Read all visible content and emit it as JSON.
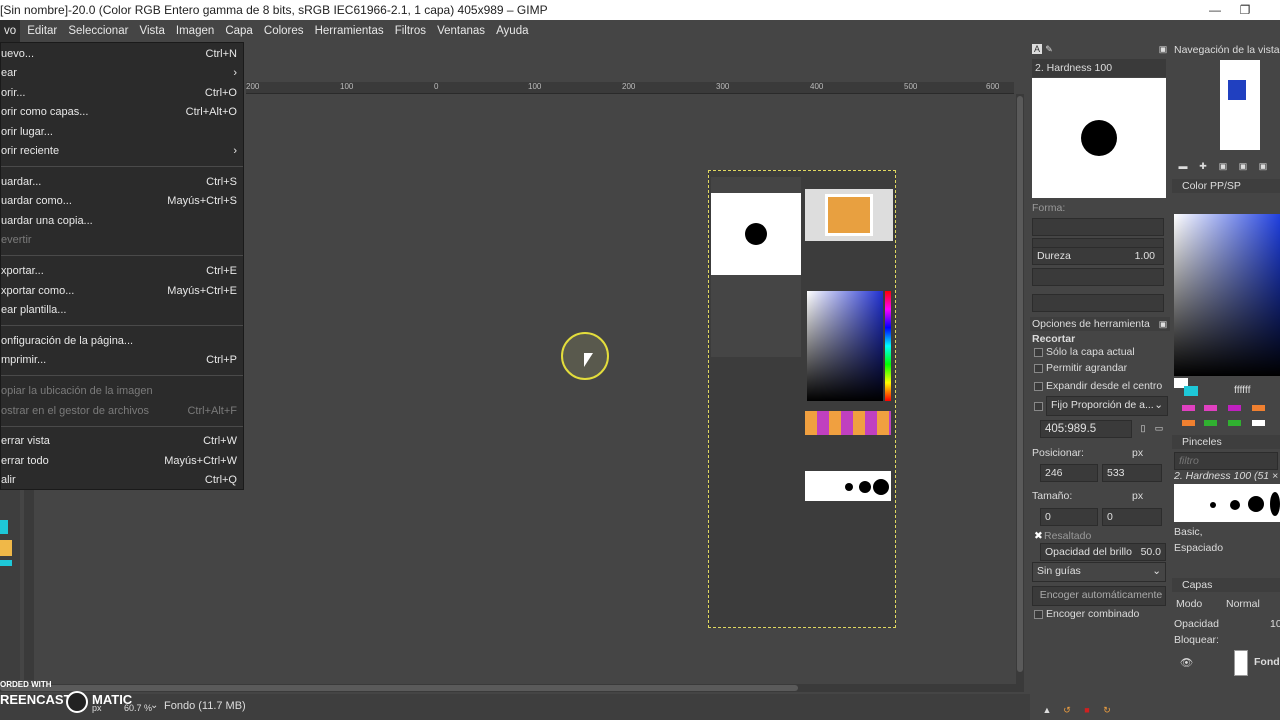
{
  "title": "[Sin nombre]-20.0 (Color RGB Entero gamma de 8 bits, sRGB IEC61966-2.1, 1 capa) 405x989 – GIMP",
  "menubar": [
    "vo",
    "Editar",
    "Seleccionar",
    "Vista",
    "Imagen",
    "Capa",
    "Colores",
    "Herramientas",
    "Filtros",
    "Ventanas",
    "Ayuda"
  ],
  "file_menu": [
    {
      "label": "uevo...",
      "accel": "Ctrl+N"
    },
    {
      "label": "ear",
      "accel": "›"
    },
    {
      "label": "orir...",
      "accel": "Ctrl+O"
    },
    {
      "label": "orir como capas...",
      "accel": "Ctrl+Alt+O"
    },
    {
      "label": "orir lugar...",
      "accel": ""
    },
    {
      "label": "orir reciente",
      "accel": "›"
    },
    {
      "label": "uardar...",
      "accel": "Ctrl+S"
    },
    {
      "label": "uardar como...",
      "accel": "Mayús+Ctrl+S"
    },
    {
      "label": "uardar una copia...",
      "accel": ""
    },
    {
      "label": "evertir",
      "accel": ""
    },
    {
      "label": "xportar...",
      "accel": "Ctrl+E"
    },
    {
      "label": "xportar como...",
      "accel": "Mayús+Ctrl+E"
    },
    {
      "label": "ear plantilla...",
      "accel": ""
    },
    {
      "label": "onfiguración de la página...",
      "accel": ""
    },
    {
      "label": "mprimir...",
      "accel": "Ctrl+P"
    },
    {
      "label": "opiar la ubicación de la imagen",
      "accel": ""
    },
    {
      "label": "ostrar en el gestor de archivos",
      "accel": "Ctrl+Alt+F"
    },
    {
      "label": "errar vista",
      "accel": "Ctrl+W"
    },
    {
      "label": "errar todo",
      "accel": "Mayús+Ctrl+W"
    },
    {
      "label": "alir",
      "accel": "Ctrl+Q"
    }
  ],
  "ruler_ticks": [
    "200",
    "100",
    "0",
    "100",
    "200",
    "300",
    "400",
    "500",
    "600"
  ],
  "status": {
    "unit": "px",
    "zoom": "60.7 %",
    "layer_info": "Fondo (11.7 MB)",
    "watermark_line1": "ORDED WITH",
    "watermark_line2": "REENCAST",
    "watermark_line3": "MATIC"
  },
  "brush_panel": {
    "title": "2. Hardness 100",
    "forma": "Forma:",
    "dureza_label": "Dureza",
    "dureza_value": "1.00"
  },
  "navigation": {
    "title": "Navegación de la vista"
  },
  "color_panel": {
    "title": "Color PP/SP",
    "hex": "ffffff"
  },
  "tool_options": {
    "title": "Opciones de herramienta",
    "tool": "Recortar",
    "opt1": "Sólo la capa actual",
    "opt2": "Permitir agrandar",
    "opt3": "Expandir desde el centro",
    "fixed": "Fijo Proporción de a...",
    "ratio": "405:989.5",
    "position_label": "Posicionar:",
    "pos_x": "246",
    "pos_y": "533",
    "unit": "px",
    "size_label": "Tamaño:",
    "size_x": "0",
    "size_y": "0",
    "highlight": "Resaltado",
    "opacity_label": "Opacidad del brillo",
    "opacity_value": "50.0",
    "guides": "Sin guías",
    "shrink": "Encoger automáticamente",
    "shrink_merged": "Encoger combinado"
  },
  "brushes": {
    "title": "Pinceles",
    "filter": "filtro",
    "current": "2. Hardness 100 (51 × 5",
    "tag": "Basic,",
    "spacing": "Espaciado"
  },
  "layers": {
    "title": "Capas",
    "mode_label": "Modo",
    "mode_value": "Normal",
    "opacity_label": "Opacidad",
    "opacity_value": "10",
    "lock_label": "Bloquear:",
    "layer_name": "Fondo"
  },
  "colors": {
    "accent": "#e3dd3c",
    "menu_bg": "#2b2b2b",
    "panel_bg": "#454545"
  }
}
